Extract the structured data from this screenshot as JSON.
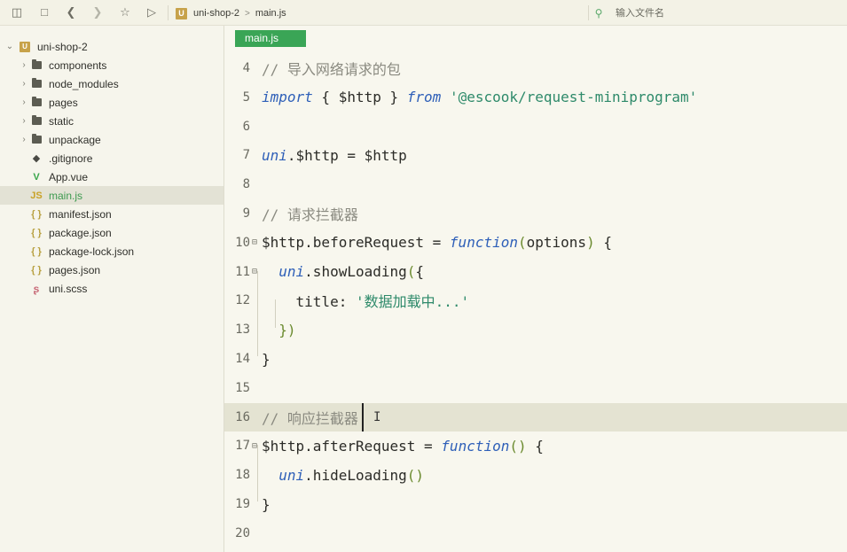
{
  "toolbar": {
    "breadcrumb_project_badge": "U",
    "breadcrumb_project": "uni-shop-2",
    "breadcrumb_separator": ">",
    "breadcrumb_file": "main.js",
    "file_search_placeholder": "输入文件名"
  },
  "sidebar": {
    "root": {
      "badge": "U",
      "label": "uni-shop-2"
    },
    "items": [
      {
        "label": "components",
        "icon": "folder-icon",
        "expandable": true
      },
      {
        "label": "node_modules",
        "icon": "folder-icon",
        "expandable": true
      },
      {
        "label": "pages",
        "icon": "folder-icon",
        "expandable": true
      },
      {
        "label": "static",
        "icon": "folder-icon",
        "expandable": true
      },
      {
        "label": "unpackage",
        "icon": "folder-icon",
        "expandable": true
      },
      {
        "label": ".gitignore",
        "icon": "git-icon",
        "expandable": false
      },
      {
        "label": "App.vue",
        "icon": "vue-icon",
        "expandable": false
      },
      {
        "label": "main.js",
        "icon": "js-icon",
        "expandable": false,
        "selected": true
      },
      {
        "label": "manifest.json",
        "icon": "json-icon",
        "expandable": false
      },
      {
        "label": "package.json",
        "icon": "json-icon",
        "expandable": false
      },
      {
        "label": "package-lock.json",
        "icon": "json-icon",
        "expandable": false
      },
      {
        "label": "pages.json",
        "icon": "json-icon",
        "expandable": false
      },
      {
        "label": "uni.scss",
        "icon": "scss-icon",
        "expandable": false
      }
    ],
    "icon_glyphs": {
      "js": "JS",
      "json": "{ }",
      "vue": "V",
      "git": "◆",
      "scss": "ʂ"
    }
  },
  "editor": {
    "active_tab": "main.js",
    "current_line": 16,
    "lines": [
      {
        "n": "4",
        "tokens": [
          {
            "t": "// 导入网络请求的包",
            "c": "comment"
          }
        ]
      },
      {
        "n": "5",
        "tokens": [
          {
            "t": "import",
            "c": "kw"
          },
          {
            "t": " { $http } ",
            "c": "key"
          },
          {
            "t": "from",
            "c": "kw"
          },
          {
            "t": " ",
            "c": "key"
          },
          {
            "t": "'@escook/request-miniprogram'",
            "c": "str"
          }
        ]
      },
      {
        "n": "6",
        "tokens": []
      },
      {
        "n": "7",
        "tokens": [
          {
            "t": "uni",
            "c": "obj"
          },
          {
            "t": ".$http = $http",
            "c": "key"
          }
        ]
      },
      {
        "n": "8",
        "tokens": []
      },
      {
        "n": "9",
        "tokens": [
          {
            "t": "// 请求拦截器",
            "c": "comment"
          }
        ]
      },
      {
        "n": "10",
        "fold": "⊟",
        "tokens": [
          {
            "t": "$http.beforeRequest = ",
            "c": "key"
          },
          {
            "t": "function",
            "c": "kw"
          },
          {
            "t": "(",
            "c": "paren"
          },
          {
            "t": "options",
            "c": "key"
          },
          {
            "t": ")",
            "c": "paren"
          },
          {
            "t": " {",
            "c": "key"
          }
        ]
      },
      {
        "n": "11",
        "fold": "⊟",
        "tokens": [
          {
            "t": "  ",
            "c": "key"
          },
          {
            "t": "uni",
            "c": "obj"
          },
          {
            "t": ".showLoading",
            "c": "key"
          },
          {
            "t": "(",
            "c": "paren"
          },
          {
            "t": "{",
            "c": "key"
          }
        ]
      },
      {
        "n": "12",
        "tokens": [
          {
            "t": "    title: ",
            "c": "key"
          },
          {
            "t": "'数据加载中...'",
            "c": "str"
          }
        ]
      },
      {
        "n": "13",
        "tokens": [
          {
            "t": "  })",
            "c": "paren"
          }
        ]
      },
      {
        "n": "14",
        "tokens": [
          {
            "t": "}",
            "c": "key"
          }
        ]
      },
      {
        "n": "15",
        "tokens": []
      },
      {
        "n": "16",
        "tokens": [
          {
            "t": "// 响应拦截器",
            "c": "comment"
          }
        ]
      },
      {
        "n": "17",
        "fold": "⊟",
        "tokens": [
          {
            "t": "$http.afterRequest = ",
            "c": "key"
          },
          {
            "t": "function",
            "c": "kw"
          },
          {
            "t": "()",
            "c": "paren"
          },
          {
            "t": " {",
            "c": "key"
          }
        ]
      },
      {
        "n": "18",
        "tokens": [
          {
            "t": "  ",
            "c": "key"
          },
          {
            "t": "uni",
            "c": "obj"
          },
          {
            "t": ".hideLoading",
            "c": "key"
          },
          {
            "t": "()",
            "c": "paren"
          }
        ]
      },
      {
        "n": "19",
        "tokens": [
          {
            "t": "}",
            "c": "key"
          }
        ]
      },
      {
        "n": "20",
        "tokens": []
      }
    ]
  },
  "colors": {
    "accent_green": "#3aa556",
    "keyword_blue": "#2e5fb8",
    "string_teal": "#2e8a6a",
    "comment_gray": "#8a8a80",
    "badge_gold": "#c7a24a"
  }
}
